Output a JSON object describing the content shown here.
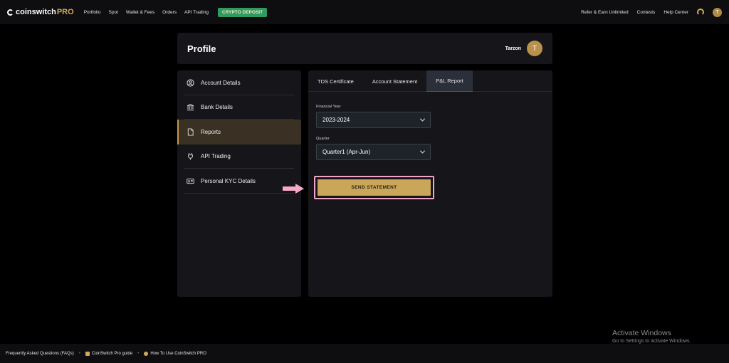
{
  "nav": {
    "logo_main": "coinswitch",
    "logo_pro": "PRO",
    "links": [
      "Portfolio",
      "Spot",
      "Wallet & Fees",
      "Orders",
      "API Trading"
    ],
    "deposit": "CRYPTO DEPOSIT",
    "right_links": [
      "Refer & Earn Unlimited",
      "Contests",
      "Help Center"
    ],
    "avatar_initial": "T"
  },
  "profile": {
    "title": "Profile",
    "user_name": "Tarzon",
    "avatar_initial": "T"
  },
  "sidebar": {
    "items": [
      {
        "label": "Account Details",
        "icon": "user-circle-icon"
      },
      {
        "label": "Bank Details",
        "icon": "bank-icon"
      },
      {
        "label": "Reports",
        "icon": "document-icon",
        "active": true
      },
      {
        "label": "API Trading",
        "icon": "plug-icon"
      },
      {
        "label": "Personal KYC Details",
        "icon": "id-card-icon"
      }
    ]
  },
  "tabs": [
    {
      "label": "TDS Certificate"
    },
    {
      "label": "Account Statement"
    },
    {
      "label": "P&L Report",
      "active": true
    }
  ],
  "form": {
    "financial_year_label": "Financial Year",
    "financial_year_value": "2023-2024",
    "quarter_label": "Quarter",
    "quarter_value": "Quarter1 (Apr-Jun)",
    "submit_label": "SEND STATEMENT"
  },
  "watermark": {
    "title": "Activate Windows",
    "subtitle": "Go to Settings to activate Windows."
  },
  "footer": {
    "faq": "Frequently Asked Questions (FAQs)",
    "guide": "CoinSwitch Pro guide",
    "howto": "How To Use CoinSwitch PRO"
  },
  "colors": {
    "accent_gold": "#c9a65a",
    "deposit_green": "#2f9b63",
    "highlight_pink": "#f3a5c8"
  }
}
